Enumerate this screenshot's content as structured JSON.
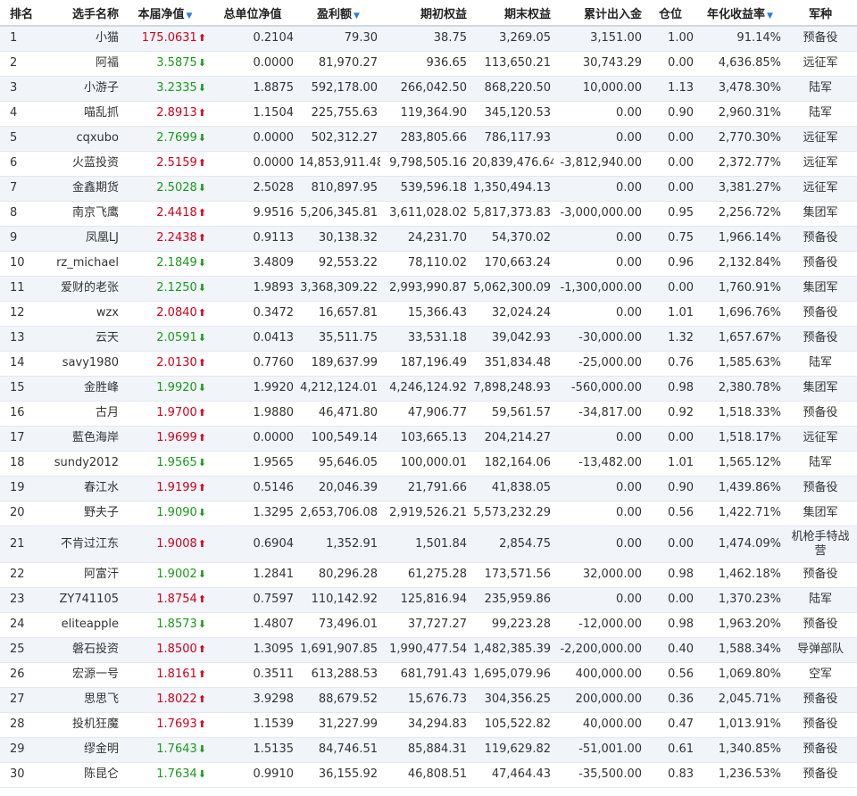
{
  "colors": {
    "up": "#d0021b",
    "down": "#1a9a1a",
    "sort_icon": "#2b7fd8",
    "row_stripe": "#f1f5fa"
  },
  "headers": {
    "rank": "排名",
    "name": "选手名称",
    "nav": "本届净值",
    "total_nav": "总单位净值",
    "profit": "盈利额",
    "initial": "期初权益",
    "final": "期末权益",
    "flow": "累计出入金",
    "position": "仓位",
    "annual": "年化收益率",
    "branch": "军种"
  },
  "icons": {
    "sort": "sort-down-triangle-icon",
    "up": "red-up-arrow-icon",
    "down": "green-down-arrow-icon"
  },
  "rows": [
    {
      "rank": "1",
      "name": "小猫",
      "nav": "175.0631",
      "dir": "up",
      "total": "0.2104",
      "profit": "79.30",
      "initial": "38.75",
      "final": "3,269.05",
      "flow": "3,151.00",
      "pos": "1.00",
      "annual": "91.14%",
      "branch": "预备役"
    },
    {
      "rank": "2",
      "name": "阿福",
      "nav": "3.5875",
      "dir": "down",
      "total": "0.0000",
      "profit": "81,970.27",
      "initial": "936.65",
      "final": "113,650.21",
      "flow": "30,743.29",
      "pos": "0.00",
      "annual": "4,636.85%",
      "branch": "远征军"
    },
    {
      "rank": "3",
      "name": "小游子",
      "nav": "3.2335",
      "dir": "down",
      "total": "1.8875",
      "profit": "592,178.00",
      "initial": "266,042.50",
      "final": "868,220.50",
      "flow": "10,000.00",
      "pos": "1.13",
      "annual": "3,478.30%",
      "branch": "陆军"
    },
    {
      "rank": "4",
      "name": "喵乱抓",
      "nav": "2.8913",
      "dir": "up",
      "total": "1.1504",
      "profit": "225,755.63",
      "initial": "119,364.90",
      "final": "345,120.53",
      "flow": "0.00",
      "pos": "0.90",
      "annual": "2,960.31%",
      "branch": "陆军"
    },
    {
      "rank": "5",
      "name": "cqxubo",
      "nav": "2.7699",
      "dir": "down",
      "total": "0.0000",
      "profit": "502,312.27",
      "initial": "283,805.66",
      "final": "786,117.93",
      "flow": "0.00",
      "pos": "0.00",
      "annual": "2,770.30%",
      "branch": "远征军"
    },
    {
      "rank": "6",
      "name": "火蓝投资",
      "nav": "2.5159",
      "dir": "up",
      "total": "0.0000",
      "profit": "14,853,911.48",
      "initial": "9,798,505.16",
      "final": "20,839,476.64",
      "flow": "-3,812,940.00",
      "pos": "0.00",
      "annual": "2,372.77%",
      "branch": "远征军"
    },
    {
      "rank": "7",
      "name": "金鑫期货",
      "nav": "2.5028",
      "dir": "down",
      "total": "2.5028",
      "profit": "810,897.95",
      "initial": "539,596.18",
      "final": "1,350,494.13",
      "flow": "0.00",
      "pos": "0.00",
      "annual": "3,381.27%",
      "branch": "远征军"
    },
    {
      "rank": "8",
      "name": "南京飞鹰",
      "nav": "2.4418",
      "dir": "up",
      "total": "9.9516",
      "profit": "5,206,345.81",
      "initial": "3,611,028.02",
      "final": "5,817,373.83",
      "flow": "-3,000,000.00",
      "pos": "0.95",
      "annual": "2,256.72%",
      "branch": "集团军"
    },
    {
      "rank": "9",
      "name": "凤凰LJ",
      "nav": "2.2438",
      "dir": "up",
      "total": "0.9113",
      "profit": "30,138.32",
      "initial": "24,231.70",
      "final": "54,370.02",
      "flow": "0.00",
      "pos": "0.75",
      "annual": "1,966.14%",
      "branch": "预备役"
    },
    {
      "rank": "10",
      "name": "rz_michael",
      "nav": "2.1849",
      "dir": "down",
      "total": "3.4809",
      "profit": "92,553.22",
      "initial": "78,110.02",
      "final": "170,663.24",
      "flow": "0.00",
      "pos": "0.96",
      "annual": "2,132.84%",
      "branch": "预备役"
    },
    {
      "rank": "11",
      "name": "爱财的老张",
      "nav": "2.1250",
      "dir": "down",
      "total": "1.9893",
      "profit": "3,368,309.22",
      "initial": "2,993,990.87",
      "final": "5,062,300.09",
      "flow": "-1,300,000.00",
      "pos": "0.00",
      "annual": "1,760.91%",
      "branch": "集团军"
    },
    {
      "rank": "12",
      "name": "wzx",
      "nav": "2.0840",
      "dir": "up",
      "total": "0.3472",
      "profit": "16,657.81",
      "initial": "15,366.43",
      "final": "32,024.24",
      "flow": "0.00",
      "pos": "1.01",
      "annual": "1,696.76%",
      "branch": "预备役"
    },
    {
      "rank": "13",
      "name": "云天",
      "nav": "2.0591",
      "dir": "down",
      "total": "0.0413",
      "profit": "35,511.75",
      "initial": "33,531.18",
      "final": "39,042.93",
      "flow": "-30,000.00",
      "pos": "1.32",
      "annual": "1,657.67%",
      "branch": "预备役"
    },
    {
      "rank": "14",
      "name": "savy1980",
      "nav": "2.0130",
      "dir": "up",
      "total": "0.7760",
      "profit": "189,637.99",
      "initial": "187,196.49",
      "final": "351,834.48",
      "flow": "-25,000.00",
      "pos": "0.76",
      "annual": "1,585.63%",
      "branch": "陆军"
    },
    {
      "rank": "15",
      "name": "金胜峰",
      "nav": "1.9920",
      "dir": "down",
      "total": "1.9920",
      "profit": "4,212,124.01",
      "initial": "4,246,124.92",
      "final": "7,898,248.93",
      "flow": "-560,000.00",
      "pos": "0.98",
      "annual": "2,380.78%",
      "branch": "集团军"
    },
    {
      "rank": "16",
      "name": "古月",
      "nav": "1.9700",
      "dir": "up",
      "total": "1.9880",
      "profit": "46,471.80",
      "initial": "47,906.77",
      "final": "59,561.57",
      "flow": "-34,817.00",
      "pos": "0.92",
      "annual": "1,518.33%",
      "branch": "预备役"
    },
    {
      "rank": "17",
      "name": "藍色海岸",
      "nav": "1.9699",
      "dir": "up",
      "total": "0.0000",
      "profit": "100,549.14",
      "initial": "103,665.13",
      "final": "204,214.27",
      "flow": "0.00",
      "pos": "0.00",
      "annual": "1,518.17%",
      "branch": "远征军"
    },
    {
      "rank": "18",
      "name": "sundy2012",
      "nav": "1.9565",
      "dir": "down",
      "total": "1.9565",
      "profit": "95,646.05",
      "initial": "100,000.01",
      "final": "182,164.06",
      "flow": "-13,482.00",
      "pos": "1.01",
      "annual": "1,565.12%",
      "branch": "陆军"
    },
    {
      "rank": "19",
      "name": "春江水",
      "nav": "1.9199",
      "dir": "up",
      "total": "0.5146",
      "profit": "20,046.39",
      "initial": "21,791.66",
      "final": "41,838.05",
      "flow": "0.00",
      "pos": "0.90",
      "annual": "1,439.86%",
      "branch": "预备役"
    },
    {
      "rank": "20",
      "name": "野夫子",
      "nav": "1.9090",
      "dir": "down",
      "total": "1.3295",
      "profit": "2,653,706.08",
      "initial": "2,919,526.21",
      "final": "5,573,232.29",
      "flow": "0.00",
      "pos": "0.56",
      "annual": "1,422.71%",
      "branch": "集团军"
    },
    {
      "rank": "21",
      "name": "不肯过江东",
      "nav": "1.9008",
      "dir": "up",
      "total": "0.6904",
      "profit": "1,352.91",
      "initial": "1,501.84",
      "final": "2,854.75",
      "flow": "0.00",
      "pos": "0.00",
      "annual": "1,474.09%",
      "branch": "机枪手特战营",
      "tall": true
    },
    {
      "rank": "22",
      "name": "阿富汗",
      "nav": "1.9002",
      "dir": "down",
      "total": "1.2841",
      "profit": "80,296.28",
      "initial": "61,275.28",
      "final": "173,571.56",
      "flow": "32,000.00",
      "pos": "0.98",
      "annual": "1,462.18%",
      "branch": "预备役"
    },
    {
      "rank": "23",
      "name": "ZY741105",
      "nav": "1.8754",
      "dir": "up",
      "total": "0.7597",
      "profit": "110,142.92",
      "initial": "125,816.94",
      "final": "235,959.86",
      "flow": "0.00",
      "pos": "0.00",
      "annual": "1,370.23%",
      "branch": "陆军"
    },
    {
      "rank": "24",
      "name": "eliteapple",
      "nav": "1.8573",
      "dir": "down",
      "total": "1.4807",
      "profit": "73,496.01",
      "initial": "37,727.27",
      "final": "99,223.28",
      "flow": "-12,000.00",
      "pos": "0.98",
      "annual": "1,963.20%",
      "branch": "预备役"
    },
    {
      "rank": "25",
      "name": "磐石投资",
      "nav": "1.8500",
      "dir": "up",
      "total": "1.3095",
      "profit": "1,691,907.85",
      "initial": "1,990,477.54",
      "final": "1,482,385.39",
      "flow": "-2,200,000.00",
      "pos": "0.40",
      "annual": "1,588.34%",
      "branch": "导弹部队"
    },
    {
      "rank": "26",
      "name": "宏源一号",
      "nav": "1.8161",
      "dir": "up",
      "total": "0.3511",
      "profit": "613,288.53",
      "initial": "681,791.43",
      "final": "1,695,079.96",
      "flow": "400,000.00",
      "pos": "0.56",
      "annual": "1,069.80%",
      "branch": "空军"
    },
    {
      "rank": "27",
      "name": "思思飞",
      "nav": "1.8022",
      "dir": "up",
      "total": "3.9298",
      "profit": "88,679.52",
      "initial": "15,676.73",
      "final": "304,356.25",
      "flow": "200,000.00",
      "pos": "0.36",
      "annual": "2,045.71%",
      "branch": "预备役"
    },
    {
      "rank": "28",
      "name": "投机狂魔",
      "nav": "1.7693",
      "dir": "up",
      "total": "1.1539",
      "profit": "31,227.99",
      "initial": "34,294.83",
      "final": "105,522.82",
      "flow": "40,000.00",
      "pos": "0.47",
      "annual": "1,013.91%",
      "branch": "预备役"
    },
    {
      "rank": "29",
      "name": "缪金明",
      "nav": "1.7643",
      "dir": "down",
      "total": "1.5135",
      "profit": "84,746.51",
      "initial": "85,884.31",
      "final": "119,629.82",
      "flow": "-51,001.00",
      "pos": "0.61",
      "annual": "1,340.85%",
      "branch": "预备役"
    },
    {
      "rank": "30",
      "name": "陈昆仑",
      "nav": "1.7634",
      "dir": "down",
      "total": "0.9910",
      "profit": "36,155.92",
      "initial": "46,808.51",
      "final": "47,464.43",
      "flow": "-35,500.00",
      "pos": "0.83",
      "annual": "1,236.53%",
      "branch": "预备役"
    }
  ]
}
